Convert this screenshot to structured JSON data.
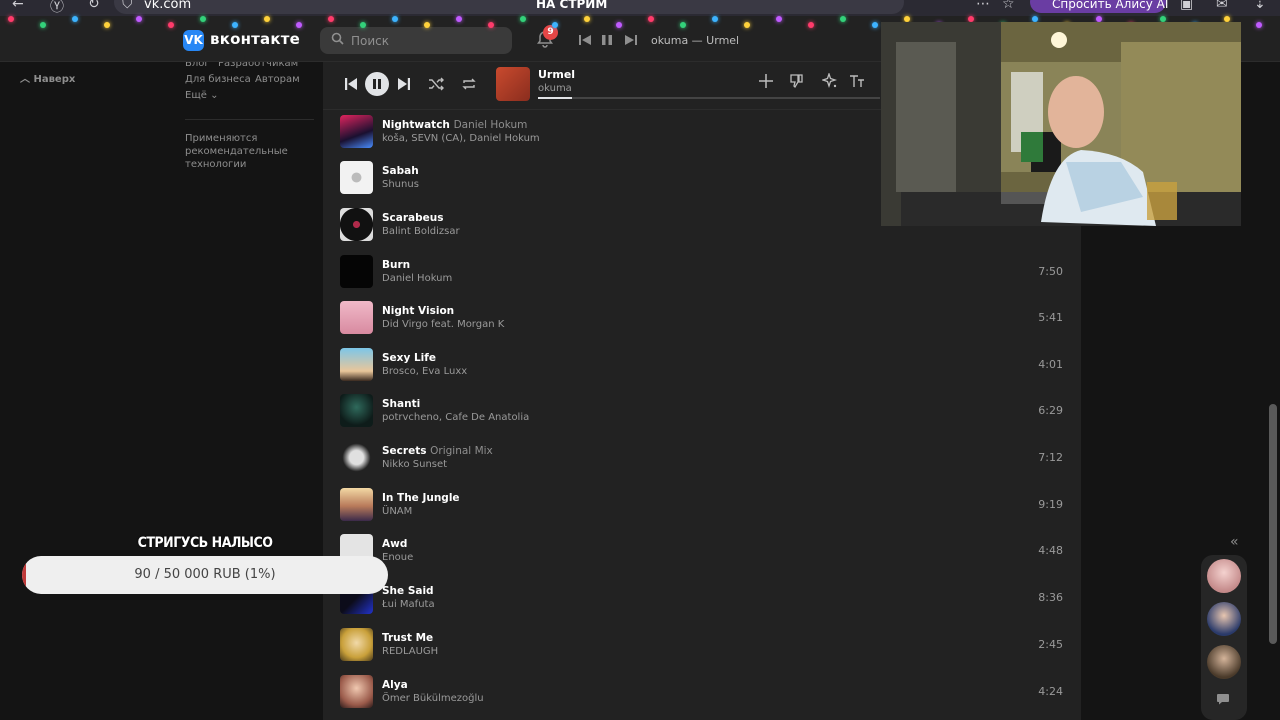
{
  "browser": {
    "url": "vk.com",
    "tab_title": "НА СТРИМ",
    "alice_button": "Спросить Алису AI"
  },
  "header": {
    "logo": "вконтакте",
    "search_placeholder": "Поиск",
    "notifications_count": "9",
    "now_playing_short": "okuma — Urmel"
  },
  "sidebar": {
    "to_top": "Наверх",
    "footer_links": [
      "Блог",
      "Разработчикам",
      "Для бизнеса",
      "Авторам",
      "Ещё ⌄"
    ],
    "note": "Применяются рекомендательные технологии"
  },
  "player": {
    "title": "Urmel",
    "artist": "okuma",
    "progress": 0.1
  },
  "tracks": [
    {
      "title": "Nightwatch",
      "subtitle": "Daniel Hokum",
      "artist": "koša, SEVN (CA), Daniel Hokum",
      "duration": "",
      "cover": "#3a1f4a"
    },
    {
      "title": "Sabah",
      "subtitle": "",
      "artist": "Shunus",
      "duration": "",
      "cover": "#e8e8e8"
    },
    {
      "title": "Scarabeus",
      "subtitle": "",
      "artist": "Balint Boldizsar",
      "duration": "",
      "cover": "#2a2a2a"
    },
    {
      "title": "Burn",
      "subtitle": "",
      "artist": "Daniel Hokum",
      "duration": "7:50",
      "cover": "#0a0a0a"
    },
    {
      "title": "Night Vision",
      "subtitle": "",
      "artist": "Did Virgo feat. Morgan K",
      "duration": "5:41",
      "cover": "#e7a7b8"
    },
    {
      "title": "Sexy Life",
      "subtitle": "",
      "artist": "Brosco, Eva Luxx",
      "duration": "4:01",
      "cover": "#5ea8c9"
    },
    {
      "title": "Shanti",
      "subtitle": "",
      "artist": "potrvcheno, Cafe De Anatolia",
      "duration": "6:29",
      "cover": "#1d3a34"
    },
    {
      "title": "Secrets",
      "subtitle": "Original Mix",
      "artist": "Nikko Sunset",
      "duration": "7:12",
      "cover": "#3c3c3c"
    },
    {
      "title": "In The Jungle",
      "subtitle": "",
      "artist": "ÜNAM",
      "duration": "9:19",
      "cover": "#c7a36b"
    },
    {
      "title": "Awd",
      "subtitle": "",
      "artist": "Enoue",
      "duration": "4:48",
      "cover": "#dcdcdc"
    },
    {
      "title": "She Said",
      "subtitle": "",
      "artist": "Łui Mafuta",
      "duration": "8:36",
      "cover": "#1b2a8a"
    },
    {
      "title": "Trust Me",
      "subtitle": "",
      "artist": "REDLAUGH",
      "duration": "2:45",
      "cover": "#d7b248"
    },
    {
      "title": "Alya",
      "subtitle": "",
      "artist": "Ömer Bükülmezoğlu",
      "duration": "4:24",
      "cover": "#c98b7a"
    }
  ],
  "stream_overlay": {
    "goal_title": "СТРИГУСЬ НАЛЫСО",
    "goal_text": "90 / 50 000 RUB (1%)",
    "goal_fraction": 0.01
  }
}
